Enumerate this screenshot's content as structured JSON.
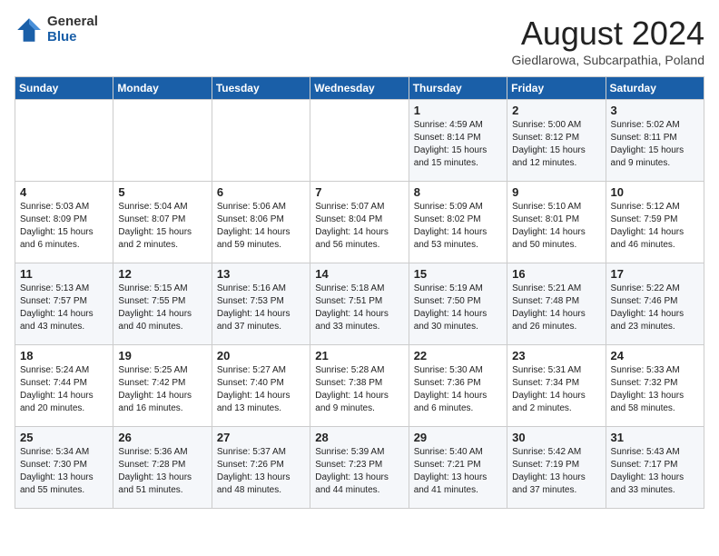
{
  "header": {
    "logo_general": "General",
    "logo_blue": "Blue",
    "month_title": "August 2024",
    "location": "Giedlarowa, Subcarpathia, Poland"
  },
  "weekdays": [
    "Sunday",
    "Monday",
    "Tuesday",
    "Wednesday",
    "Thursday",
    "Friday",
    "Saturday"
  ],
  "weeks": [
    [
      {
        "day": "",
        "info": ""
      },
      {
        "day": "",
        "info": ""
      },
      {
        "day": "",
        "info": ""
      },
      {
        "day": "",
        "info": ""
      },
      {
        "day": "1",
        "info": "Sunrise: 4:59 AM\nSunset: 8:14 PM\nDaylight: 15 hours\nand 15 minutes."
      },
      {
        "day": "2",
        "info": "Sunrise: 5:00 AM\nSunset: 8:12 PM\nDaylight: 15 hours\nand 12 minutes."
      },
      {
        "day": "3",
        "info": "Sunrise: 5:02 AM\nSunset: 8:11 PM\nDaylight: 15 hours\nand 9 minutes."
      }
    ],
    [
      {
        "day": "4",
        "info": "Sunrise: 5:03 AM\nSunset: 8:09 PM\nDaylight: 15 hours\nand 6 minutes."
      },
      {
        "day": "5",
        "info": "Sunrise: 5:04 AM\nSunset: 8:07 PM\nDaylight: 15 hours\nand 2 minutes."
      },
      {
        "day": "6",
        "info": "Sunrise: 5:06 AM\nSunset: 8:06 PM\nDaylight: 14 hours\nand 59 minutes."
      },
      {
        "day": "7",
        "info": "Sunrise: 5:07 AM\nSunset: 8:04 PM\nDaylight: 14 hours\nand 56 minutes."
      },
      {
        "day": "8",
        "info": "Sunrise: 5:09 AM\nSunset: 8:02 PM\nDaylight: 14 hours\nand 53 minutes."
      },
      {
        "day": "9",
        "info": "Sunrise: 5:10 AM\nSunset: 8:01 PM\nDaylight: 14 hours\nand 50 minutes."
      },
      {
        "day": "10",
        "info": "Sunrise: 5:12 AM\nSunset: 7:59 PM\nDaylight: 14 hours\nand 46 minutes."
      }
    ],
    [
      {
        "day": "11",
        "info": "Sunrise: 5:13 AM\nSunset: 7:57 PM\nDaylight: 14 hours\nand 43 minutes."
      },
      {
        "day": "12",
        "info": "Sunrise: 5:15 AM\nSunset: 7:55 PM\nDaylight: 14 hours\nand 40 minutes."
      },
      {
        "day": "13",
        "info": "Sunrise: 5:16 AM\nSunset: 7:53 PM\nDaylight: 14 hours\nand 37 minutes."
      },
      {
        "day": "14",
        "info": "Sunrise: 5:18 AM\nSunset: 7:51 PM\nDaylight: 14 hours\nand 33 minutes."
      },
      {
        "day": "15",
        "info": "Sunrise: 5:19 AM\nSunset: 7:50 PM\nDaylight: 14 hours\nand 30 minutes."
      },
      {
        "day": "16",
        "info": "Sunrise: 5:21 AM\nSunset: 7:48 PM\nDaylight: 14 hours\nand 26 minutes."
      },
      {
        "day": "17",
        "info": "Sunrise: 5:22 AM\nSunset: 7:46 PM\nDaylight: 14 hours\nand 23 minutes."
      }
    ],
    [
      {
        "day": "18",
        "info": "Sunrise: 5:24 AM\nSunset: 7:44 PM\nDaylight: 14 hours\nand 20 minutes."
      },
      {
        "day": "19",
        "info": "Sunrise: 5:25 AM\nSunset: 7:42 PM\nDaylight: 14 hours\nand 16 minutes."
      },
      {
        "day": "20",
        "info": "Sunrise: 5:27 AM\nSunset: 7:40 PM\nDaylight: 14 hours\nand 13 minutes."
      },
      {
        "day": "21",
        "info": "Sunrise: 5:28 AM\nSunset: 7:38 PM\nDaylight: 14 hours\nand 9 minutes."
      },
      {
        "day": "22",
        "info": "Sunrise: 5:30 AM\nSunset: 7:36 PM\nDaylight: 14 hours\nand 6 minutes."
      },
      {
        "day": "23",
        "info": "Sunrise: 5:31 AM\nSunset: 7:34 PM\nDaylight: 14 hours\nand 2 minutes."
      },
      {
        "day": "24",
        "info": "Sunrise: 5:33 AM\nSunset: 7:32 PM\nDaylight: 13 hours\nand 58 minutes."
      }
    ],
    [
      {
        "day": "25",
        "info": "Sunrise: 5:34 AM\nSunset: 7:30 PM\nDaylight: 13 hours\nand 55 minutes."
      },
      {
        "day": "26",
        "info": "Sunrise: 5:36 AM\nSunset: 7:28 PM\nDaylight: 13 hours\nand 51 minutes."
      },
      {
        "day": "27",
        "info": "Sunrise: 5:37 AM\nSunset: 7:26 PM\nDaylight: 13 hours\nand 48 minutes."
      },
      {
        "day": "28",
        "info": "Sunrise: 5:39 AM\nSunset: 7:23 PM\nDaylight: 13 hours\nand 44 minutes."
      },
      {
        "day": "29",
        "info": "Sunrise: 5:40 AM\nSunset: 7:21 PM\nDaylight: 13 hours\nand 41 minutes."
      },
      {
        "day": "30",
        "info": "Sunrise: 5:42 AM\nSunset: 7:19 PM\nDaylight: 13 hours\nand 37 minutes."
      },
      {
        "day": "31",
        "info": "Sunrise: 5:43 AM\nSunset: 7:17 PM\nDaylight: 13 hours\nand 33 minutes."
      }
    ]
  ]
}
